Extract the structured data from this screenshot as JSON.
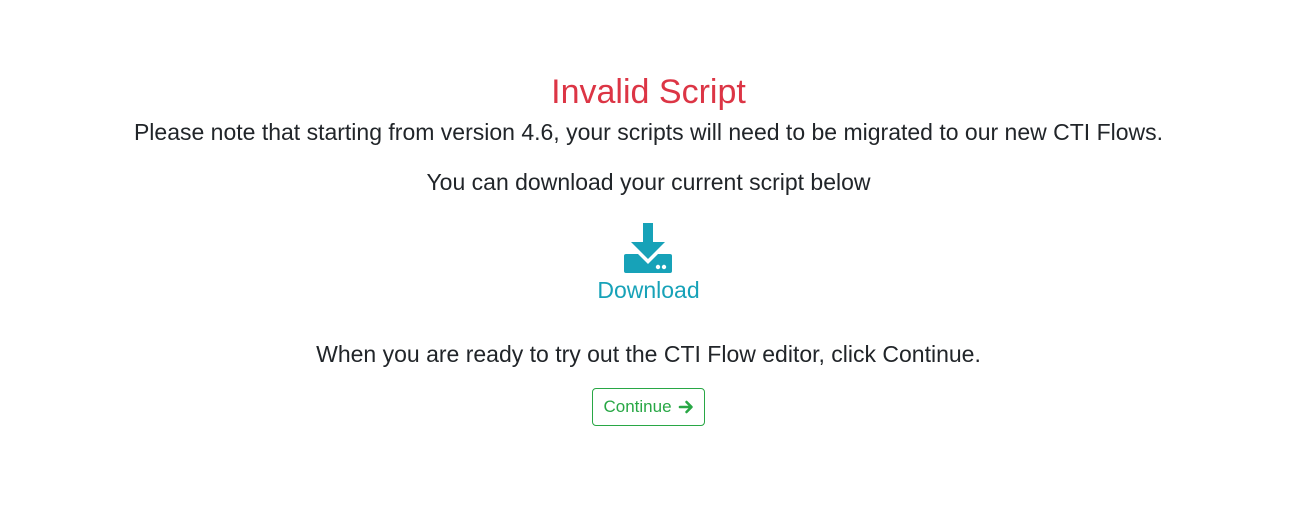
{
  "page": {
    "title": "Invalid Script",
    "note": "Please note that starting from version 4.6, your scripts will need to be migrated to our new CTI Flows.",
    "download_hint": "You can download your current script below",
    "download_label": "Download",
    "ready_text": "When you are ready to try out the CTI Flow editor, click Continue.",
    "continue_label": "Continue"
  },
  "colors": {
    "title": "#dc3545",
    "text": "#212529",
    "download": "#17a2b8",
    "continue": "#28a745"
  },
  "icons": {
    "download": "download-icon",
    "continue_arrow": "arrow-right-icon"
  }
}
